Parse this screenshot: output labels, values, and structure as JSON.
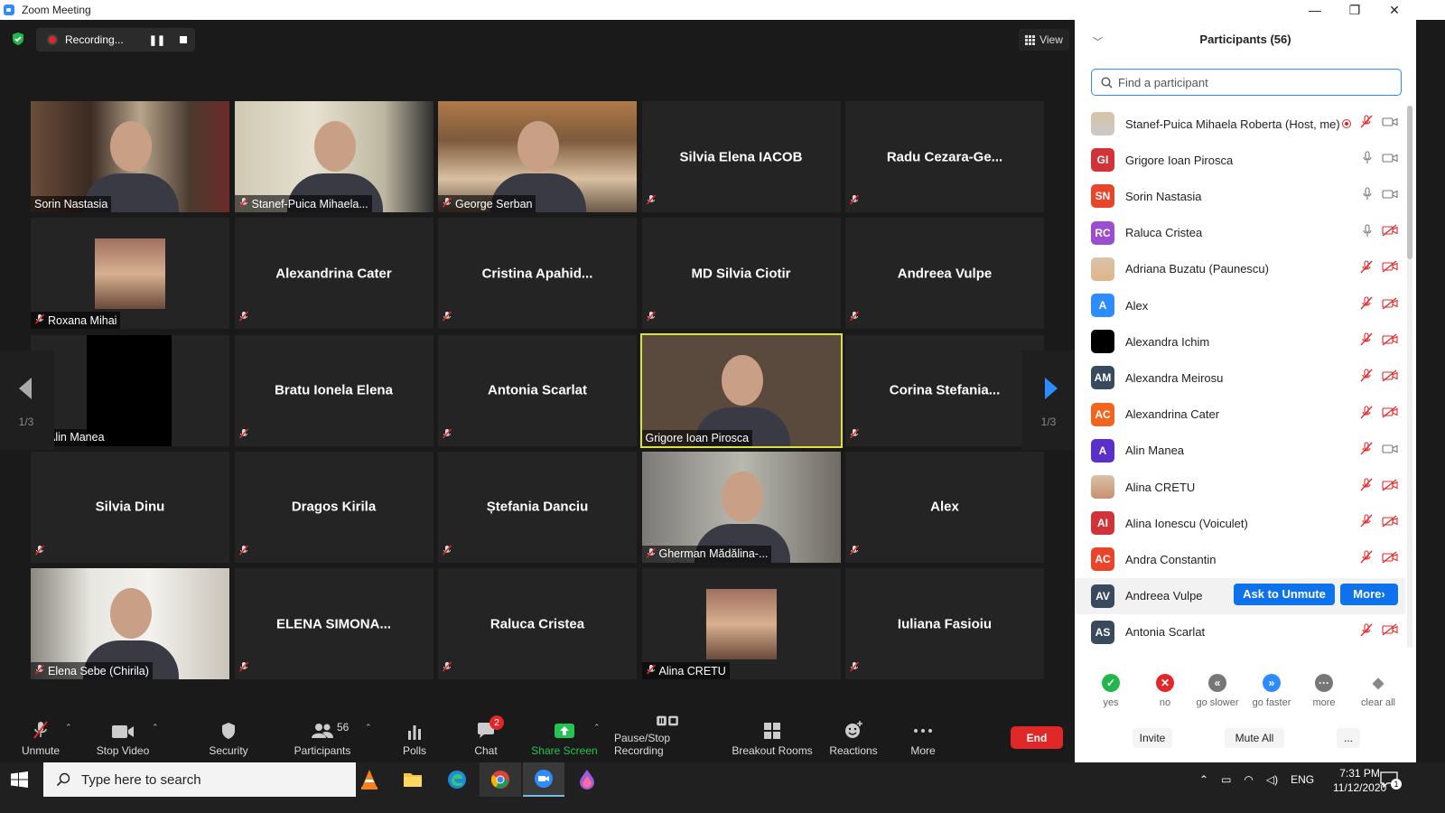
{
  "window": {
    "title": "Zoom Meeting"
  },
  "recording": {
    "label": "Recording..."
  },
  "view": {
    "label": "View"
  },
  "gallery": {
    "page_left": "1/3",
    "page_right": "1/3",
    "tiles": [
      {
        "name": "Sorin Nastasia",
        "video": true,
        "muted": false
      },
      {
        "name": "Stanef-Puica Mihaela...",
        "video": true,
        "muted": true
      },
      {
        "name": "George Serban",
        "video": true,
        "muted": true
      },
      {
        "name": "Silvia Elena IACOB",
        "video": false,
        "muted": true
      },
      {
        "name": "Radu  Cezara-Ge...",
        "video": false,
        "muted": true
      },
      {
        "name": "Roxana Mihai",
        "video": "photo",
        "muted": true
      },
      {
        "name": "Alexandrina Cater",
        "video": false,
        "muted": true
      },
      {
        "name": "Cristina  Apahid...",
        "video": false,
        "muted": true
      },
      {
        "name": "MD Silvia Ciotir",
        "video": false,
        "muted": true
      },
      {
        "name": "Andreea Vulpe",
        "video": false,
        "muted": true
      },
      {
        "name": "Alin Manea",
        "video": "black",
        "muted": true
      },
      {
        "name": "Bratu Ionela Elena",
        "video": false,
        "muted": true
      },
      {
        "name": "Antonia Scarlat",
        "video": false,
        "muted": true
      },
      {
        "name": "Grigore Ioan Pirosca",
        "video": true,
        "muted": false,
        "active": true
      },
      {
        "name": "Corina  Stefania...",
        "video": false,
        "muted": true
      },
      {
        "name": "Silvia Dinu",
        "video": false,
        "muted": true
      },
      {
        "name": "Dragos Kirila",
        "video": false,
        "muted": true
      },
      {
        "name": "Ștefania Danciu",
        "video": false,
        "muted": true
      },
      {
        "name": "Gherman Mădălina-...",
        "video": true,
        "muted": true
      },
      {
        "name": "Alex",
        "video": false,
        "muted": true
      },
      {
        "name": "Elena Sebe (Chirila)",
        "video": true,
        "muted": true
      },
      {
        "name": "ELENA  SIMONA...",
        "video": false,
        "muted": true
      },
      {
        "name": "Raluca Cristea",
        "video": false,
        "muted": true
      },
      {
        "name": "Alina CRETU",
        "video": "photo",
        "muted": true
      },
      {
        "name": "Iuliana Fasioiu",
        "video": false,
        "muted": true
      }
    ]
  },
  "toolbar": {
    "unmute": "Unmute",
    "stop_video": "Stop Video",
    "security": "Security",
    "participants": "Participants",
    "participants_count": "56",
    "polls": "Polls",
    "chat": "Chat",
    "chat_badge": "2",
    "share_screen": "Share Screen",
    "pause_stop_recording": "Pause/Stop Recording",
    "breakout_rooms": "Breakout Rooms",
    "reactions": "Reactions",
    "more": "More",
    "end": "End"
  },
  "panel": {
    "title": "Participants (56)",
    "search_placeholder": "Find a participant",
    "ask_to_unmute": "Ask to Unmute",
    "more": "More",
    "participants": [
      {
        "initials": "",
        "name": "Stanef-Puica Mihaela Roberta (Host, me)",
        "color": "#c9c9c9",
        "photo": true,
        "mic": "muted",
        "cam": "on",
        "rec": true
      },
      {
        "initials": "GI",
        "name": "Grigore Ioan Pirosca",
        "color": "#d13438",
        "mic": "on",
        "cam": "on"
      },
      {
        "initials": "SN",
        "name": "Sorin Nastasia",
        "color": "#e8452c",
        "mic": "on",
        "cam": "on"
      },
      {
        "initials": "RC",
        "name": "Raluca Cristea",
        "color": "#9b4fd0",
        "mic": "on",
        "cam": "off"
      },
      {
        "initials": "",
        "name": "Adriana Buzatu (Paunescu)",
        "color": "#e0b48a",
        "photo": true,
        "mic": "muted",
        "cam": "off"
      },
      {
        "initials": "A",
        "name": "Alex",
        "color": "#2d8cff",
        "mic": "muted",
        "cam": "off"
      },
      {
        "initials": "",
        "name": "Alexandra Ichim",
        "color": "#000000",
        "mic": "muted",
        "cam": "off"
      },
      {
        "initials": "AM",
        "name": "Alexandra Meirosu",
        "color": "#3a4a5e",
        "mic": "muted",
        "cam": "off"
      },
      {
        "initials": "AC",
        "name": "Alexandrina Cater",
        "color": "#f0661e",
        "mic": "muted",
        "cam": "off"
      },
      {
        "initials": "A",
        "name": "Alin Manea",
        "color": "#5b2fc9",
        "mic": "muted",
        "cam": "on"
      },
      {
        "initials": "",
        "name": "Alina CRETU",
        "color": "#c89070",
        "photo": true,
        "mic": "muted",
        "cam": "off"
      },
      {
        "initials": "AI",
        "name": "Alina Ionescu (Voiculet)",
        "color": "#d13438",
        "mic": "muted",
        "cam": "off"
      },
      {
        "initials": "AC",
        "name": "Andra Constantin",
        "color": "#e8452c",
        "mic": "muted",
        "cam": "off"
      },
      {
        "initials": "AV",
        "name": "Andreea Vulpe",
        "color": "#3a4a5e",
        "mic": "muted",
        "cam": "off",
        "highlight": true
      },
      {
        "initials": "AS",
        "name": "Antonia Scarlat",
        "color": "#3a4a5e",
        "mic": "muted",
        "cam": "off"
      }
    ],
    "feedback": [
      {
        "label": "yes",
        "color": "#23b64a",
        "glyph": "✓"
      },
      {
        "label": "no",
        "color": "#e02828",
        "glyph": "✕"
      },
      {
        "label": "go slower",
        "color": "#777777",
        "glyph": "«"
      },
      {
        "label": "go faster",
        "color": "#2d8cff",
        "glyph": "»"
      },
      {
        "label": "more",
        "color": "#777777",
        "glyph": "···"
      },
      {
        "label": "clear all",
        "color": "#888888",
        "glyph": "◆"
      }
    ],
    "invite": "Invite",
    "mute_all": "Mute All",
    "ellipsis": "..."
  },
  "taskbar": {
    "search_placeholder": "Type here to search",
    "lang": "ENG",
    "time": "7:31 PM",
    "date": "11/12/2020",
    "notif": "1"
  }
}
